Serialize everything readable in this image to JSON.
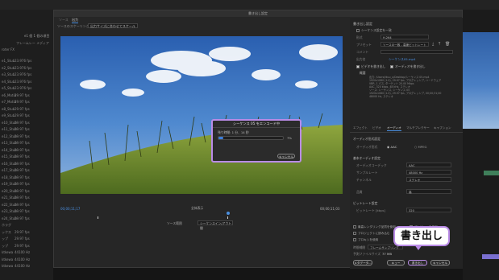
{
  "background": {
    "project_items": [
      {
        "name": "e1_Stub",
        "fps": "23.976 fps"
      },
      {
        "name": "e2_Stub",
        "fps": "23.976 fps"
      },
      {
        "name": "e3_Stub",
        "fps": "23.976 fps"
      },
      {
        "name": "e4_Stub",
        "fps": "23.976 fps"
      },
      {
        "name": "e5_Stub",
        "fps": "23.976 fps"
      },
      {
        "name": "e6_Motio",
        "fps": "29.97 fps"
      },
      {
        "name": "e7_Motio",
        "fps": "29.97 fps"
      },
      {
        "name": "e8_Stub",
        "fps": "29.97 fps"
      },
      {
        "name": "e9_Stub",
        "fps": "29.97 fps"
      },
      {
        "name": "e10_Stub",
        "fps": "29.97 fps"
      },
      {
        "name": "e11_Stub",
        "fps": "29.97 fps"
      },
      {
        "name": "e12_Stub",
        "fps": "29.97 fps"
      },
      {
        "name": "e13_Stub",
        "fps": "29.97 fps"
      },
      {
        "name": "e14_Stub",
        "fps": "29.97 fps"
      },
      {
        "name": "e15_Stub",
        "fps": "29.97 fps"
      },
      {
        "name": "e16_Stub",
        "fps": "29.97 fps"
      },
      {
        "name": "e17_Stub",
        "fps": "29.97 fps"
      },
      {
        "name": "e18_Stub",
        "fps": "29.97 fps"
      },
      {
        "name": "e19_Stub",
        "fps": "29.97 fps"
      },
      {
        "name": "e20_Stub",
        "fps": "29.97 fps"
      },
      {
        "name": "e21_Stub",
        "fps": "29.97 fps"
      },
      {
        "name": "e22_Stub",
        "fps": "29.97 fps"
      },
      {
        "name": "e23_Stub",
        "fps": "29.97 fps"
      },
      {
        "name": "e24_Stub",
        "fps": "29.97 fps"
      },
      {
        "name": "ホラグ",
        "fps": ""
      },
      {
        "name": "ックス",
        "fps": "29.97 fps"
      },
      {
        "name": "ップ",
        "fps": "29.97 fps"
      },
      {
        "name": "ップ",
        "fps": "29.97 fps"
      },
      {
        "name": "ktkewa",
        "fps": "44100 Hz"
      },
      {
        "name": "ktkewa",
        "fps": "44100 Hz"
      },
      {
        "name": "ktkewa",
        "fps": "44100 Hz"
      }
    ],
    "project_header": "e1 個 1 個の項目",
    "project_cols": "フレームレー  メディア",
    "project_name": "roter FX"
  },
  "dialog": {
    "title": "書き出し設定",
    "source_tab": "ソース",
    "output_tab": "出力",
    "scale_label": "ソースのスケーリング",
    "scale_value": "出力サイズに合わせてスケール",
    "progress_modal": {
      "title": "シーケンス 05 をエンコード中",
      "time_remaining": "残り時間: 1 分、14 秒",
      "percent": "7%",
      "progress": 0.07,
      "cancel": "キャンセル"
    },
    "timecode_left": "00;00;11;17",
    "timecode_right": "00;00;11;03",
    "fit_label": "全体表示",
    "source_range_label": "ソース範囲",
    "source_range_value": "シーケンスイン/アウト間",
    "settings": {
      "header": "書き出し設定",
      "match_sequence": "シーケンス設定を一致",
      "format_label": "形式",
      "format_value": "H.264",
      "preset_label": "プリセット",
      "preset_value": "ソースの一致 - 高速ビットレート",
      "comment_label": "コメント",
      "output_label": "出力名",
      "output_value": "シーケンス05.mp4",
      "export_video": "ビデオを書き出し",
      "export_audio": "オーディオを書き出し",
      "summary_header": "概要",
      "summary_lines": [
        "出力: /Users/tkuu_u/Desktop/シーケンス 05.mp4",
        "1920x1080 (1.0), 29.97 fps, プログレッシブ, ハードウェア",
        "VBR, 1 パス, ターゲット 20.00 Mbps",
        "AAC, 320 kbps, 48 kHz, ステレオ",
        "ソース: シーケンス, シーケンス 05",
        "1920x1080 (1.0), 29.97 fps, プログレッシブ, 00;00;31;00",
        "48000 Hz, ステレオ"
      ],
      "tabs": [
        "エフェクト",
        "ビデオ",
        "オーディオ",
        "マルチプレクサー",
        "キャプション"
      ],
      "active_tab": "オーディオ",
      "audio_format_header": "オーディオ形式設定",
      "audio_format_label": "オーディオ形式",
      "audio_format_aac": "AAC",
      "audio_format_mpeg": "MPEG",
      "basic_audio_header": "基本オーディオ設定",
      "codec_label": "オーディオコーデック",
      "codec_value": "AAC",
      "sample_rate_label": "サンプルレート",
      "sample_rate_value": "48000 Hz",
      "channels_label": "チャンネル",
      "channels_value": "ステレオ",
      "quality_label": "品質",
      "quality_value": "高",
      "bitrate_header": "ビットレート設定",
      "bitrate_label": "ビットレート [kbps]",
      "bitrate_value": "320",
      "max_render_quality": "最高レンダリング品質を使用",
      "preview_use": "プレビューを使用",
      "proxy_use": "プロキシを使用",
      "import_to_project": "プロジェクトに読み込む",
      "time_interp_label": "時間補間",
      "time_interp_value": "フレームサンプリング",
      "estimated_size_label": "予測ファイルサイズ",
      "estimated_size_value": "77 MB",
      "buttons": {
        "metadata": "メタデータ...",
        "queue": "キュー",
        "export": "書き出し",
        "cancel": "キャンセル"
      }
    }
  },
  "callout": "書き出し",
  "colors": {
    "accent": "#4a8fe0",
    "callout_border": "#b98be6",
    "progress_fill": "#3d7fdc"
  }
}
